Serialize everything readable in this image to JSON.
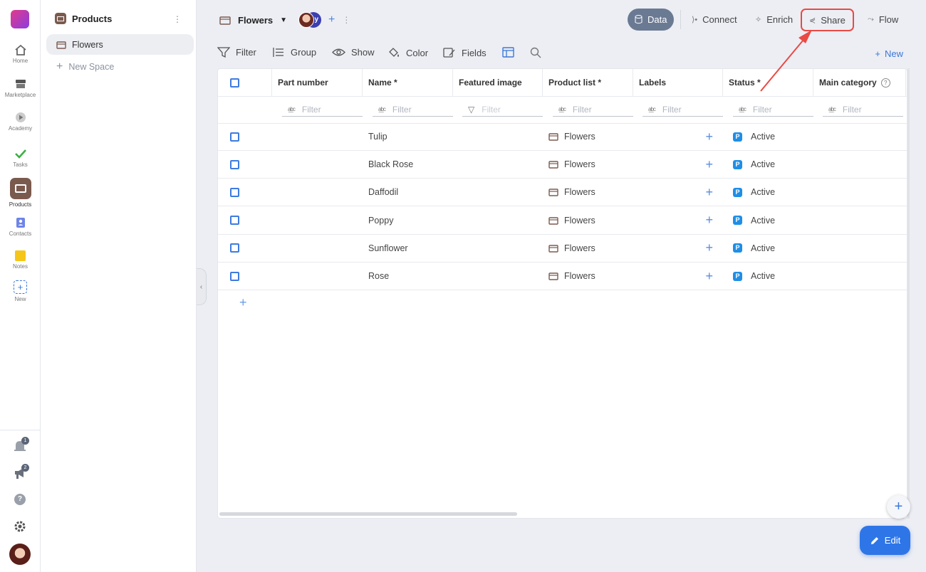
{
  "rail": {
    "items": [
      {
        "label": "Home",
        "icon": "home-icon"
      },
      {
        "label": "Marketplace",
        "icon": "store-icon"
      },
      {
        "label": "Academy",
        "icon": "play-icon"
      },
      {
        "label": "Tasks",
        "icon": "check-icon"
      },
      {
        "label": "Products",
        "icon": "box-icon"
      },
      {
        "label": "Contacts",
        "icon": "contact-icon"
      },
      {
        "label": "Notes",
        "icon": "note-icon"
      },
      {
        "label": "New",
        "icon": "add-icon"
      }
    ],
    "notifications_count": "1",
    "announcements_count": "2",
    "help_glyph": "?"
  },
  "spaces": {
    "title": "Products",
    "items": [
      {
        "label": "Flowers"
      }
    ],
    "new_space_label": "New Space"
  },
  "topbar": {
    "crumb": "Flowers",
    "second_avatar_letter": "y",
    "buttons": {
      "data": "Data",
      "connect": "Connect",
      "enrich": "Enrich",
      "share": "Share",
      "flow": "Flow"
    }
  },
  "toolbar": {
    "filter": "Filter",
    "group": "Group",
    "show": "Show",
    "color": "Color",
    "fields": "Fields",
    "new": "New"
  },
  "table": {
    "columns": [
      "Part number",
      "Name *",
      "Featured image",
      "Product list *",
      "Labels",
      "Status *",
      "Main category"
    ],
    "filter_placeholder": "Filter",
    "rows": [
      {
        "part_number": "",
        "name": "Tulip",
        "product_list": "Flowers",
        "status": "Active"
      },
      {
        "part_number": "",
        "name": "Black Rose",
        "product_list": "Flowers",
        "status": "Active"
      },
      {
        "part_number": "",
        "name": "Daffodil",
        "product_list": "Flowers",
        "status": "Active"
      },
      {
        "part_number": "",
        "name": "Poppy",
        "product_list": "Flowers",
        "status": "Active"
      },
      {
        "part_number": "",
        "name": "Sunflower",
        "product_list": "Flowers",
        "status": "Active"
      },
      {
        "part_number": "",
        "name": "Rose",
        "product_list": "Flowers",
        "status": "Active"
      }
    ],
    "status_badge_letter": "P"
  },
  "actions": {
    "edit": "Edit"
  },
  "colors": {
    "accent": "#2e76e8",
    "highlight": "#e94a44",
    "status": "#1f8ee6",
    "active_tab": "#6b7a93"
  }
}
